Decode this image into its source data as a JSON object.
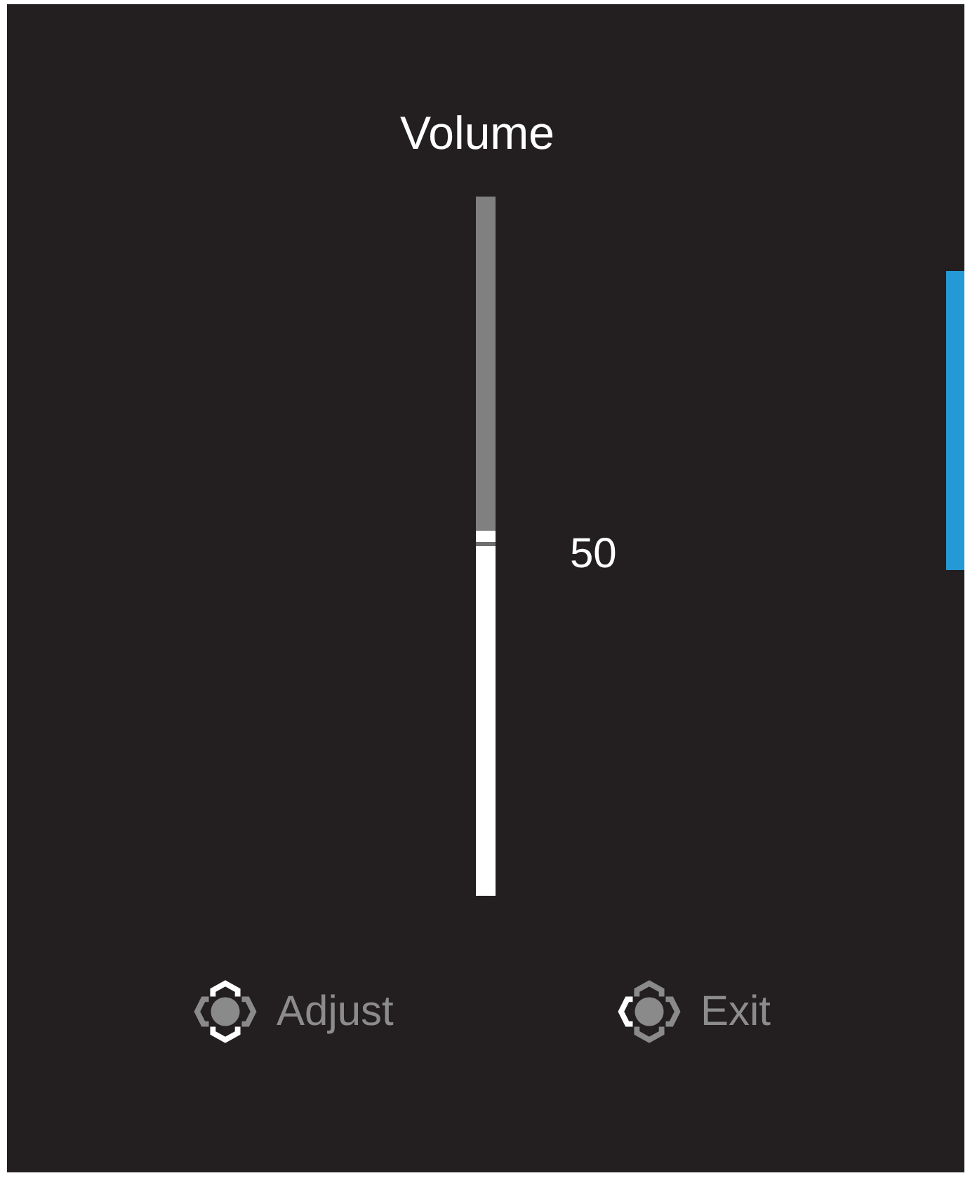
{
  "title": "Volume",
  "slider": {
    "level": 0.5,
    "reading": "50"
  },
  "legend": [
    {
      "label": "Adjust",
      "directions": {
        "up": true,
        "down": true,
        "left": false,
        "right": false
      }
    },
    {
      "label": "Exit",
      "directions": {
        "up": false,
        "down": false,
        "left": true,
        "right": false
      }
    }
  ]
}
